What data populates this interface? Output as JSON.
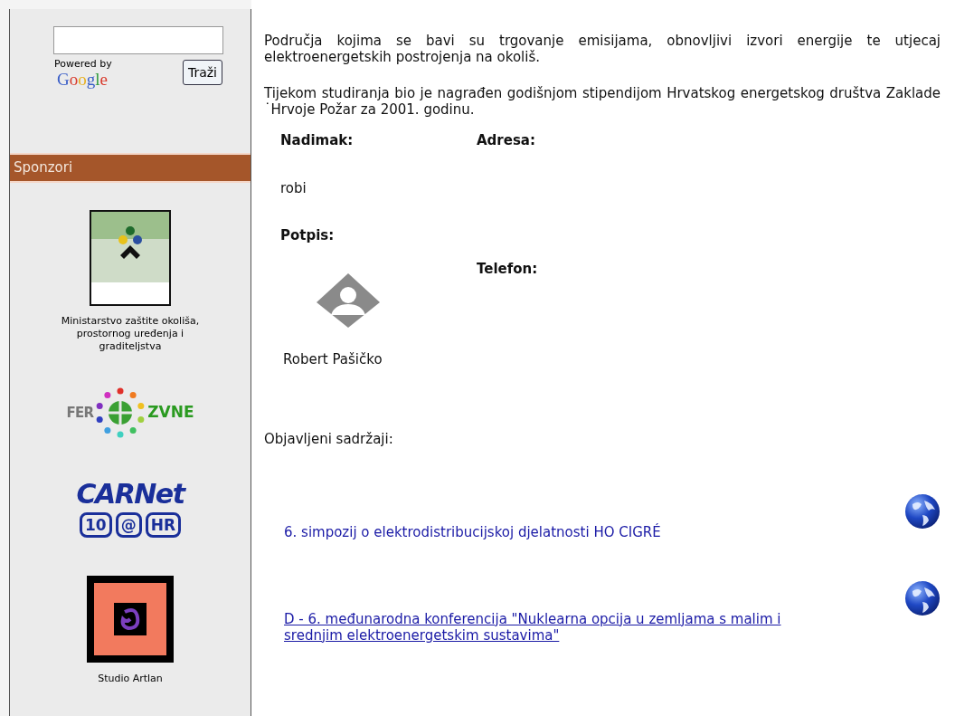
{
  "search": {
    "button": "Traži",
    "powered_by": "Powered by",
    "google": "Google"
  },
  "sidebar": {
    "heading": "Sponzori",
    "sponsors": [
      {
        "kind": "ministry",
        "caption": "Ministarstvo zaštite okoliša, prostornog uređenja i graditeljstva"
      },
      {
        "kind": "fer",
        "logo_texts": [
          "FER",
          "ZVNE"
        ]
      },
      {
        "kind": "carnet",
        "logo_texts": [
          "CARNet",
          "10",
          "@",
          "HR"
        ]
      },
      {
        "kind": "artlan",
        "caption": "Studio Artlan"
      }
    ]
  },
  "bio": [
    "Područja kojima se bavi su trgovanje emisijama, obnovljivi izvori energije te utjecaj elektroenergetskih postrojenja na okoliš.",
    "Tijekom studiranja bio je nagrađen godišnjom stipendijom Hrvatskog energetskog društva Zaklade ˙Hrvoje Požar  za 2001. godinu."
  ],
  "profile": {
    "nickname_label": "Nadimak:",
    "address_label": "Adresa:",
    "nickname": "robi",
    "signature_label": "Potpis:",
    "phone_label": "Telefon:",
    "name": "Robert Pašičko"
  },
  "publications": {
    "heading": "Objavljeni sadržaji:",
    "items": [
      {
        "title": "6. simpozij o elektrodistribucijskoj djelatnosti HO CIGRÉ",
        "underlined": false
      },
      {
        "title": "D - 6. međunarodna konferencija \"Nuklearna opcija u zemljama s malim i srednjim elektroenergetskim sustavima\"",
        "underlined": true
      }
    ]
  }
}
